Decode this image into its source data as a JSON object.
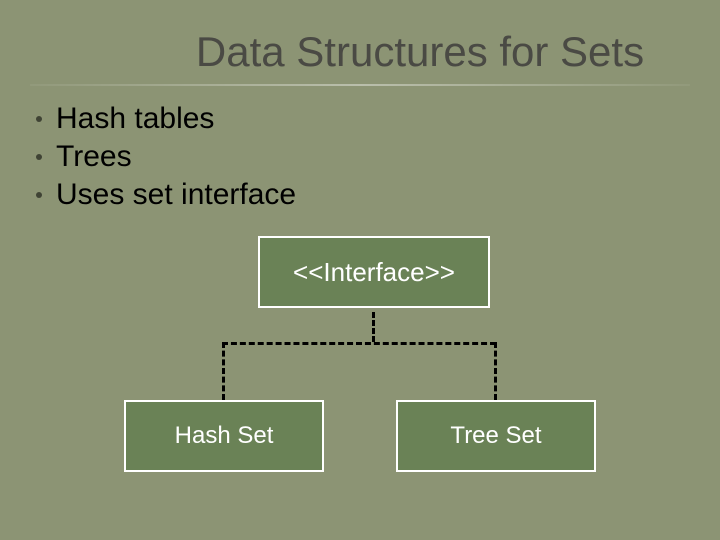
{
  "title": "Data Structures for Sets",
  "bullets": [
    "Hash tables",
    "Trees",
    "Uses set interface"
  ],
  "diagram": {
    "interface_label": "<<Interface>>",
    "left_child": "Hash Set",
    "right_child": "Tree Set"
  }
}
